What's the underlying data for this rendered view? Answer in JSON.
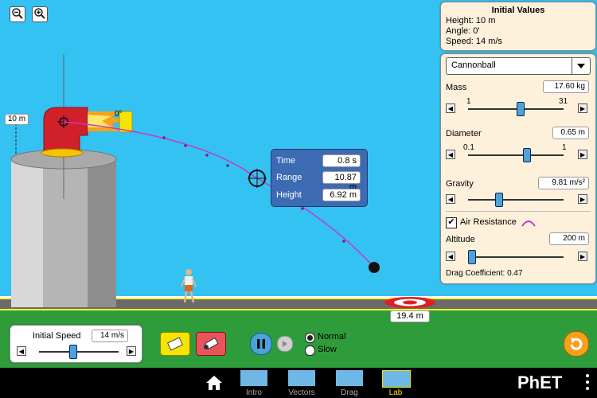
{
  "initial_values": {
    "title": "Initial Values",
    "height": "Height: 10 m",
    "angle": "Angle: 0'",
    "speed": "Speed: 14 m/s"
  },
  "projectile": {
    "selected": "Cannonball",
    "mass_label": "Mass",
    "mass_value": "17.60 kg",
    "mass_min": "1",
    "mass_max": "31",
    "diameter_label": "Diameter",
    "diameter_value": "0.65 m",
    "diameter_min": "0.1",
    "diameter_max": "1",
    "gravity_label": "Gravity",
    "gravity_value": "9.81 m/s²",
    "air_resistance_label": "Air Resistance",
    "air_resistance_checked": true,
    "altitude_label": "Altitude",
    "altitude_value": "200 m",
    "drag_coefficient": "Drag Coefficient: 0.47"
  },
  "measure": {
    "time_label": "Time",
    "time_value": "0.8 s",
    "range_label": "Range",
    "range_value": "10.87 m",
    "height_label": "Height",
    "height_value": "6.92 m"
  },
  "cannon": {
    "height_label": "10 m",
    "angle_label": "0°"
  },
  "target": {
    "distance": "19.4 m"
  },
  "initial_speed": {
    "label": "Initial Speed",
    "value": "14 m/s"
  },
  "playback": {
    "normal_label": "Normal",
    "slow_label": "Slow",
    "selected": "Normal"
  },
  "nav": {
    "tabs": [
      "Intro",
      "Vectors",
      "Drag",
      "Lab"
    ],
    "active": "Lab",
    "brand": "PhET"
  },
  "colors": {
    "sky": "#33c2f2",
    "grass": "#2f9c3c",
    "trajectory": "#cc33cc",
    "panel_bg": "#fef1dc",
    "accent_orange": "#f7a11a"
  }
}
